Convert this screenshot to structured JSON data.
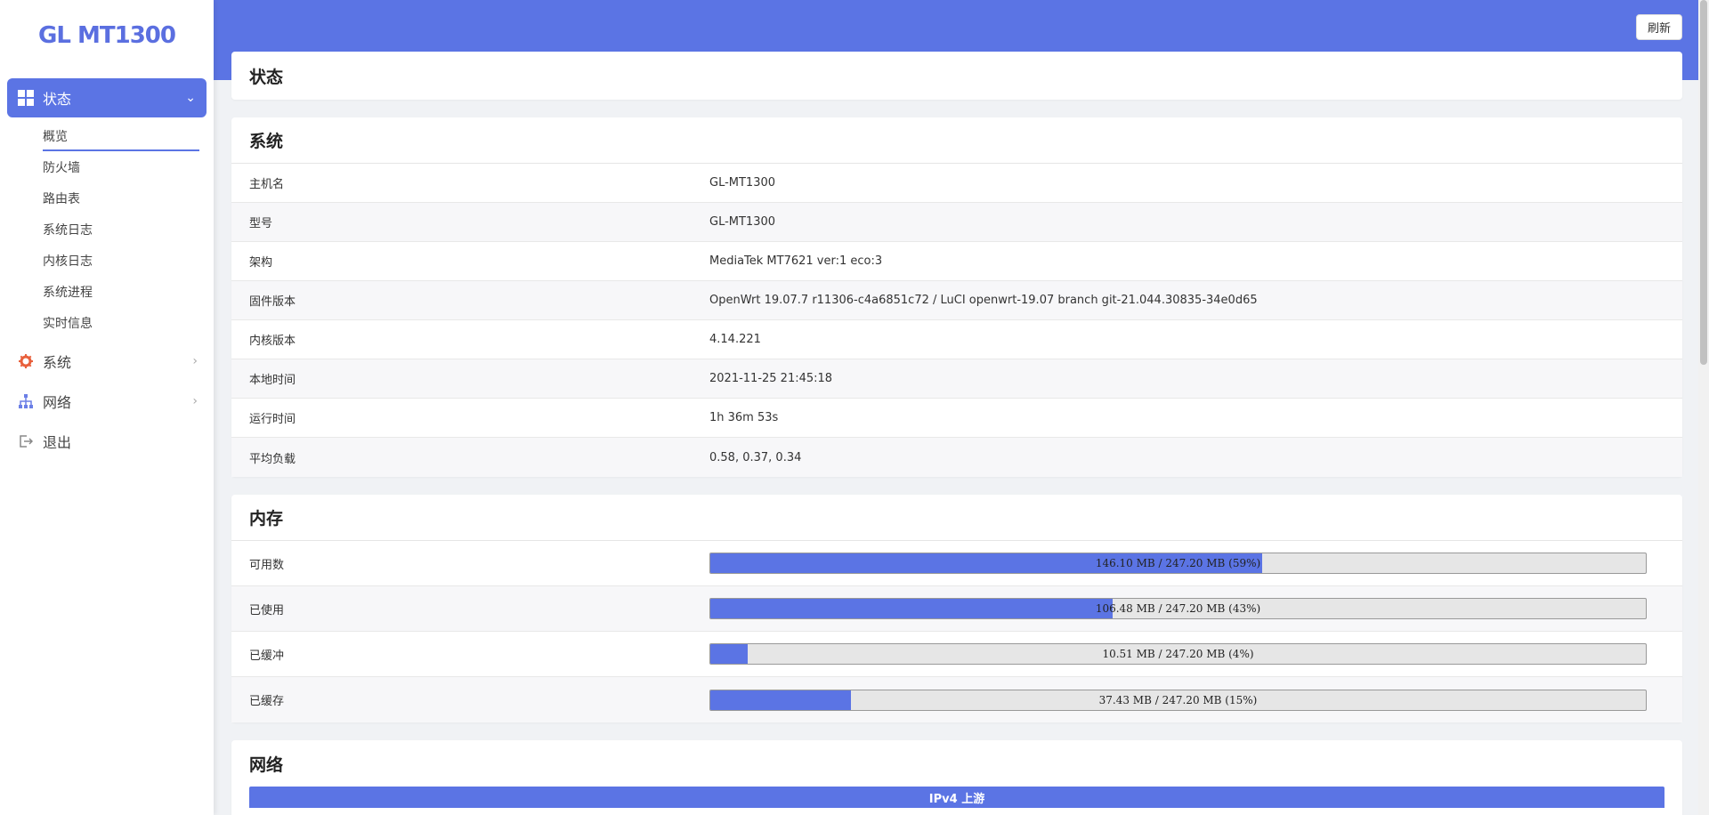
{
  "brand": "GL MT1300",
  "sidebar": {
    "active": {
      "label": "状态"
    },
    "submenu": [
      "概览",
      "防火墙",
      "路由表",
      "系统日志",
      "内核日志",
      "系统进程",
      "实时信息"
    ],
    "items": [
      {
        "label": "系统"
      },
      {
        "label": "网络"
      },
      {
        "label": "退出"
      }
    ]
  },
  "header": {
    "refresh_label": "刷新"
  },
  "page_title": "状态",
  "system": {
    "title": "系统",
    "rows": [
      {
        "key": "主机名",
        "value": "GL-MT1300"
      },
      {
        "key": "型号",
        "value": "GL-MT1300"
      },
      {
        "key": "架构",
        "value": "MediaTek MT7621 ver:1 eco:3"
      },
      {
        "key": "固件版本",
        "value": "OpenWrt 19.07.7 r11306-c4a6851c72 / LuCI openwrt-19.07 branch git-21.044.30835-34e0d65"
      },
      {
        "key": "内核版本",
        "value": "4.14.221"
      },
      {
        "key": "本地时间",
        "value": "2021-11-25 21:45:18"
      },
      {
        "key": "运行时间",
        "value": "1h 36m 53s"
      },
      {
        "key": "平均负载",
        "value": "0.58, 0.37, 0.34"
      }
    ]
  },
  "memory": {
    "title": "内存",
    "rows": [
      {
        "key": "可用数",
        "text": "146.10 MB / 247.20 MB (59%)",
        "fraction": 0.59
      },
      {
        "key": "已使用",
        "text": "106.48 MB / 247.20 MB (43%)",
        "fraction": 0.43
      },
      {
        "key": "已缓冲",
        "text": "10.51 MB / 247.20 MB (4%)",
        "fraction": 0.04
      },
      {
        "key": "已缓存",
        "text": "37.43 MB / 247.20 MB (15%)",
        "fraction": 0.15
      }
    ]
  },
  "network": {
    "title": "网络",
    "ipv4_upstream_label": "IPv4 上游"
  },
  "colors": {
    "accent": "#5b74e4",
    "brand": "#5b6fe0",
    "system_icon": "#e8603c"
  }
}
